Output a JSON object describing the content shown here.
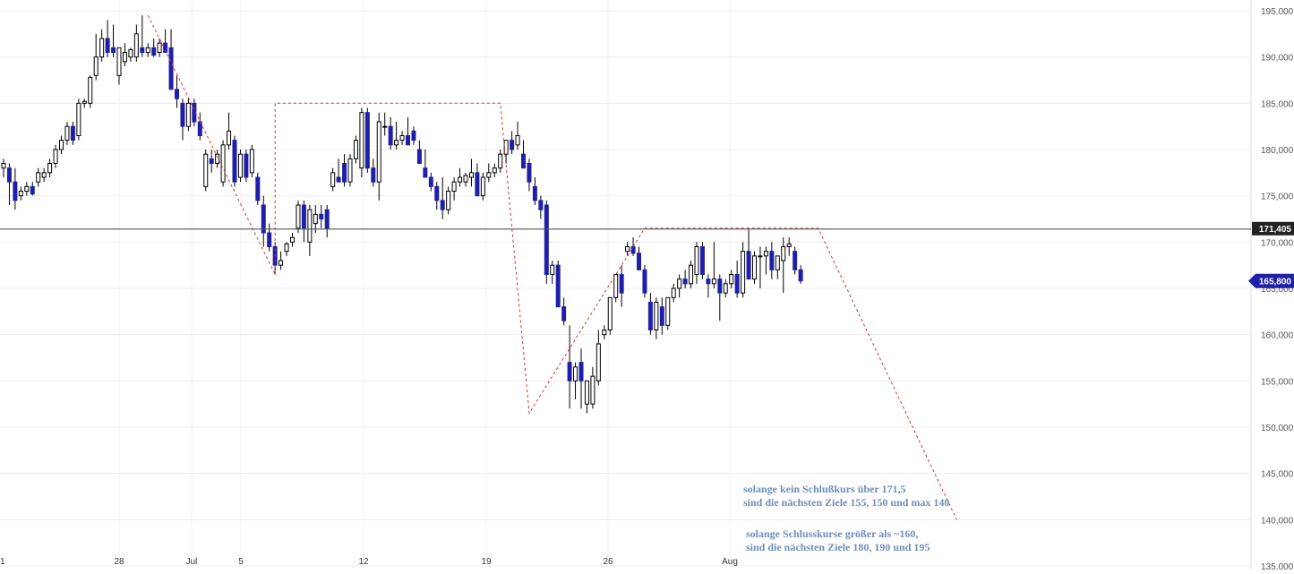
{
  "chart_data": {
    "type": "candlestick",
    "ylim": [
      135000,
      195000
    ],
    "y_ticks": [
      "135,000",
      "140,000",
      "145,000",
      "150,000",
      "155,000",
      "160,000",
      "165,000",
      "170,000",
      "175,000",
      "180,000",
      "185,000",
      "190,000",
      "195,000"
    ],
    "x_ticks": [
      "1",
      "28",
      "Jul",
      "5",
      "12",
      "19",
      "26",
      "Aug"
    ],
    "grid": true,
    "horizontal_line": {
      "value": 171405,
      "label": "171,405"
    },
    "last_price": {
      "value": 165800,
      "label": "165,800"
    },
    "colors": {
      "up_candle_fill": "#ffffff",
      "down_candle_fill": "#1f1fa8",
      "wick": "#000000",
      "pattern_line": "#e03030",
      "price_tag": "#1f1fa8",
      "line_tag": "#222222"
    },
    "candles": [
      {
        "o": 178000,
        "h": 179000,
        "l": 177000,
        "c": 178500
      },
      {
        "o": 178000,
        "h": 178500,
        "l": 174000,
        "c": 176500
      },
      {
        "o": 176500,
        "h": 178000,
        "l": 173500,
        "c": 174500
      },
      {
        "o": 175000,
        "h": 176000,
        "l": 174500,
        "c": 175500
      },
      {
        "o": 175500,
        "h": 176500,
        "l": 175000,
        "c": 176000
      },
      {
        "o": 176000,
        "h": 176500,
        "l": 175000,
        "c": 175200
      },
      {
        "o": 176500,
        "h": 178000,
        "l": 176000,
        "c": 177500
      },
      {
        "o": 177000,
        "h": 178000,
        "l": 176500,
        "c": 177500
      },
      {
        "o": 177500,
        "h": 179000,
        "l": 177000,
        "c": 178500
      },
      {
        "o": 178500,
        "h": 180500,
        "l": 178000,
        "c": 180000
      },
      {
        "o": 180000,
        "h": 181500,
        "l": 179500,
        "c": 181000
      },
      {
        "o": 181000,
        "h": 183000,
        "l": 180500,
        "c": 182500
      },
      {
        "o": 182500,
        "h": 183000,
        "l": 180500,
        "c": 181000
      },
      {
        "o": 181500,
        "h": 185500,
        "l": 181000,
        "c": 185000
      },
      {
        "o": 185000,
        "h": 185500,
        "l": 184500,
        "c": 185200
      },
      {
        "o": 185000,
        "h": 188000,
        "l": 184500,
        "c": 187800
      },
      {
        "o": 188000,
        "h": 192500,
        "l": 187500,
        "c": 190000
      },
      {
        "o": 190000,
        "h": 193000,
        "l": 189500,
        "c": 192000
      },
      {
        "o": 192000,
        "h": 194000,
        "l": 190000,
        "c": 190500
      },
      {
        "o": 191000,
        "h": 193500,
        "l": 190000,
        "c": 190500
      },
      {
        "o": 188000,
        "h": 191000,
        "l": 187000,
        "c": 191000
      },
      {
        "o": 189500,
        "h": 191500,
        "l": 189000,
        "c": 190500
      },
      {
        "o": 190000,
        "h": 191000,
        "l": 189500,
        "c": 190800
      },
      {
        "o": 190000,
        "h": 193500,
        "l": 189500,
        "c": 192500
      },
      {
        "o": 191000,
        "h": 194500,
        "l": 190000,
        "c": 190500
      },
      {
        "o": 190500,
        "h": 191500,
        "l": 190000,
        "c": 191000
      },
      {
        "o": 191000,
        "h": 192000,
        "l": 190000,
        "c": 190200
      },
      {
        "o": 190500,
        "h": 192000,
        "l": 190000,
        "c": 191500
      },
      {
        "o": 191500,
        "h": 193000,
        "l": 191000,
        "c": 190500
      },
      {
        "o": 191000,
        "h": 193000,
        "l": 190000,
        "c": 186500
      },
      {
        "o": 186500,
        "h": 188000,
        "l": 184500,
        "c": 185500
      },
      {
        "o": 185000,
        "h": 185500,
        "l": 181000,
        "c": 182500
      },
      {
        "o": 182500,
        "h": 185500,
        "l": 182000,
        "c": 185000
      },
      {
        "o": 185000,
        "h": 185500,
        "l": 182500,
        "c": 183000
      },
      {
        "o": 183000,
        "h": 184000,
        "l": 181000,
        "c": 181500
      },
      {
        "o": 176000,
        "h": 180000,
        "l": 175500,
        "c": 179500
      },
      {
        "o": 179000,
        "h": 180000,
        "l": 177500,
        "c": 178500
      },
      {
        "o": 178500,
        "h": 180000,
        "l": 178000,
        "c": 179500
      },
      {
        "o": 176500,
        "h": 181000,
        "l": 176000,
        "c": 180500
      },
      {
        "o": 180500,
        "h": 184000,
        "l": 180000,
        "c": 182000
      },
      {
        "o": 181000,
        "h": 181500,
        "l": 176000,
        "c": 176500
      },
      {
        "o": 177000,
        "h": 180000,
        "l": 176500,
        "c": 179500
      },
      {
        "o": 179500,
        "h": 180000,
        "l": 176500,
        "c": 177000
      },
      {
        "o": 177500,
        "h": 180500,
        "l": 177000,
        "c": 180000
      },
      {
        "o": 177000,
        "h": 177500,
        "l": 174000,
        "c": 174500
      },
      {
        "o": 174000,
        "h": 175000,
        "l": 169500,
        "c": 171000
      },
      {
        "o": 171000,
        "h": 172000,
        "l": 169000,
        "c": 169500
      },
      {
        "o": 169500,
        "h": 170000,
        "l": 166500,
        "c": 167500
      },
      {
        "o": 167500,
        "h": 169000,
        "l": 167000,
        "c": 168000
      },
      {
        "o": 169000,
        "h": 170000,
        "l": 168500,
        "c": 169800
      },
      {
        "o": 170000,
        "h": 171000,
        "l": 169500,
        "c": 170500
      },
      {
        "o": 171500,
        "h": 174500,
        "l": 171000,
        "c": 174000
      },
      {
        "o": 174000,
        "h": 174500,
        "l": 170000,
        "c": 171500
      },
      {
        "o": 170000,
        "h": 174000,
        "l": 168500,
        "c": 173500
      },
      {
        "o": 172000,
        "h": 174000,
        "l": 171000,
        "c": 173000
      },
      {
        "o": 173000,
        "h": 174000,
        "l": 171500,
        "c": 172500
      },
      {
        "o": 173500,
        "h": 174000,
        "l": 170500,
        "c": 171500
      },
      {
        "o": 176000,
        "h": 178000,
        "l": 175500,
        "c": 177500
      },
      {
        "o": 177000,
        "h": 179000,
        "l": 176500,
        "c": 176500
      },
      {
        "o": 178500,
        "h": 179500,
        "l": 176000,
        "c": 176500
      },
      {
        "o": 176500,
        "h": 179500,
        "l": 176000,
        "c": 179000
      },
      {
        "o": 179000,
        "h": 181500,
        "l": 178500,
        "c": 181000
      },
      {
        "o": 178000,
        "h": 184500,
        "l": 177000,
        "c": 184000
      },
      {
        "o": 184000,
        "h": 184500,
        "l": 177500,
        "c": 178000
      },
      {
        "o": 178000,
        "h": 179000,
        "l": 176000,
        "c": 176500
      },
      {
        "o": 176500,
        "h": 184000,
        "l": 174500,
        "c": 183000
      },
      {
        "o": 182500,
        "h": 184000,
        "l": 181500,
        "c": 182500
      },
      {
        "o": 182500,
        "h": 183500,
        "l": 180000,
        "c": 180500
      },
      {
        "o": 180500,
        "h": 183000,
        "l": 180000,
        "c": 181000
      },
      {
        "o": 181000,
        "h": 182000,
        "l": 180500,
        "c": 181500
      },
      {
        "o": 181500,
        "h": 183500,
        "l": 181000,
        "c": 180500
      },
      {
        "o": 182000,
        "h": 182500,
        "l": 180500,
        "c": 181000
      },
      {
        "o": 180000,
        "h": 181000,
        "l": 178500,
        "c": 178500
      },
      {
        "o": 178000,
        "h": 180000,
        "l": 177500,
        "c": 177000
      },
      {
        "o": 177000,
        "h": 177500,
        "l": 175500,
        "c": 176000
      },
      {
        "o": 176000,
        "h": 176500,
        "l": 173500,
        "c": 174500
      },
      {
        "o": 174500,
        "h": 177000,
        "l": 172500,
        "c": 173500
      },
      {
        "o": 173500,
        "h": 176000,
        "l": 173000,
        "c": 175500
      },
      {
        "o": 175500,
        "h": 177000,
        "l": 174500,
        "c": 176500
      },
      {
        "o": 176500,
        "h": 178000,
        "l": 176000,
        "c": 177000
      },
      {
        "o": 176500,
        "h": 177500,
        "l": 176000,
        "c": 177200
      },
      {
        "o": 177000,
        "h": 179000,
        "l": 176000,
        "c": 177500
      },
      {
        "o": 177500,
        "h": 178500,
        "l": 176500,
        "c": 175000
      },
      {
        "o": 175000,
        "h": 177500,
        "l": 174500,
        "c": 177000
      },
      {
        "o": 177000,
        "h": 178500,
        "l": 176500,
        "c": 177500
      },
      {
        "o": 177500,
        "h": 178500,
        "l": 177000,
        "c": 178000
      },
      {
        "o": 178000,
        "h": 180000,
        "l": 177500,
        "c": 179500
      },
      {
        "o": 179500,
        "h": 181000,
        "l": 178500,
        "c": 181000
      },
      {
        "o": 181000,
        "h": 182000,
        "l": 179500,
        "c": 180000
      },
      {
        "o": 180500,
        "h": 183000,
        "l": 180000,
        "c": 181500
      },
      {
        "o": 179500,
        "h": 181000,
        "l": 178000,
        "c": 178000
      },
      {
        "o": 178500,
        "h": 179000,
        "l": 175500,
        "c": 176500
      },
      {
        "o": 176000,
        "h": 177000,
        "l": 174000,
        "c": 174500
      },
      {
        "o": 174500,
        "h": 175000,
        "l": 172500,
        "c": 173500
      },
      {
        "o": 174000,
        "h": 174500,
        "l": 165500,
        "c": 166500
      },
      {
        "o": 166500,
        "h": 168000,
        "l": 165500,
        "c": 167500
      },
      {
        "o": 167500,
        "h": 168000,
        "l": 163000,
        "c": 163000
      },
      {
        "o": 163000,
        "h": 164000,
        "l": 161000,
        "c": 161500
      },
      {
        "o": 157000,
        "h": 161000,
        "l": 152000,
        "c": 155000
      },
      {
        "o": 155000,
        "h": 157000,
        "l": 153000,
        "c": 156500
      },
      {
        "o": 157000,
        "h": 158500,
        "l": 152000,
        "c": 155000
      },
      {
        "o": 152500,
        "h": 155000,
        "l": 151500,
        "c": 155000
      },
      {
        "o": 152500,
        "h": 156500,
        "l": 152000,
        "c": 155500
      },
      {
        "o": 155000,
        "h": 160500,
        "l": 154500,
        "c": 159000
      },
      {
        "o": 160000,
        "h": 161000,
        "l": 159500,
        "c": 160500
      },
      {
        "o": 160500,
        "h": 164000,
        "l": 160000,
        "c": 164000
      },
      {
        "o": 164000,
        "h": 166500,
        "l": 163500,
        "c": 166500
      },
      {
        "o": 166500,
        "h": 167500,
        "l": 163000,
        "c": 164500
      },
      {
        "o": 169000,
        "h": 170000,
        "l": 168500,
        "c": 169500
      },
      {
        "o": 169500,
        "h": 170500,
        "l": 168500,
        "c": 168800
      },
      {
        "o": 168800,
        "h": 169500,
        "l": 167000,
        "c": 167000
      },
      {
        "o": 167000,
        "h": 167500,
        "l": 164000,
        "c": 164500
      },
      {
        "o": 163500,
        "h": 164500,
        "l": 160000,
        "c": 160500
      },
      {
        "o": 160500,
        "h": 164000,
        "l": 159500,
        "c": 163500
      },
      {
        "o": 163000,
        "h": 164000,
        "l": 160000,
        "c": 161000
      },
      {
        "o": 161000,
        "h": 164000,
        "l": 160500,
        "c": 164000
      },
      {
        "o": 164000,
        "h": 165500,
        "l": 163500,
        "c": 165000
      },
      {
        "o": 165000,
        "h": 166500,
        "l": 164000,
        "c": 166000
      },
      {
        "o": 166000,
        "h": 167000,
        "l": 165000,
        "c": 165500
      },
      {
        "o": 165500,
        "h": 168000,
        "l": 165000,
        "c": 167500
      },
      {
        "o": 166500,
        "h": 170000,
        "l": 165500,
        "c": 169500
      },
      {
        "o": 169500,
        "h": 170000,
        "l": 166000,
        "c": 166500
      },
      {
        "o": 166000,
        "h": 166500,
        "l": 164000,
        "c": 165500
      },
      {
        "o": 165500,
        "h": 170000,
        "l": 165000,
        "c": 166000
      },
      {
        "o": 166000,
        "h": 166500,
        "l": 161500,
        "c": 164500
      },
      {
        "o": 164500,
        "h": 166000,
        "l": 164000,
        "c": 165500
      },
      {
        "o": 165500,
        "h": 167000,
        "l": 165000,
        "c": 166500
      },
      {
        "o": 166500,
        "h": 168000,
        "l": 164000,
        "c": 164500
      },
      {
        "o": 164500,
        "h": 170000,
        "l": 164000,
        "c": 169000
      },
      {
        "o": 169000,
        "h": 171500,
        "l": 166000,
        "c": 166000
      },
      {
        "o": 166000,
        "h": 169000,
        "l": 165500,
        "c": 168500
      },
      {
        "o": 168500,
        "h": 169500,
        "l": 165000,
        "c": 168500
      },
      {
        "o": 168500,
        "h": 169500,
        "l": 166500,
        "c": 169000
      },
      {
        "o": 169000,
        "h": 170000,
        "l": 166000,
        "c": 167000
      },
      {
        "o": 167000,
        "h": 168500,
        "l": 166000,
        "c": 168500
      },
      {
        "o": 168000,
        "h": 170500,
        "l": 164500,
        "c": 169500
      },
      {
        "o": 169500,
        "h": 170500,
        "l": 168500,
        "c": 169800
      },
      {
        "o": 169000,
        "h": 169500,
        "l": 166500,
        "c": 167000
      },
      {
        "o": 167000,
        "h": 167500,
        "l": 165500,
        "c": 165800
      }
    ],
    "pattern_lines": [
      {
        "points": [
          [
            25,
            194500
          ],
          [
            47,
            166500
          ],
          [
            47,
            185000
          ],
          [
            86,
            185000
          ],
          [
            91,
            151500
          ],
          [
            111,
            171500
          ],
          [
            141,
            171500
          ],
          [
            165,
            140000
          ]
        ]
      }
    ],
    "annotations": [
      {
        "lines": [
          "solange kein Schlußkurs  über 171,5",
          "sind die nächsten Ziele 155, 150 und max 140"
        ]
      },
      {
        "lines": [
          "solange Schlusskurse größer als ~160,",
          "sind die nächsten Ziele 180, 190 und 195"
        ]
      }
    ]
  }
}
